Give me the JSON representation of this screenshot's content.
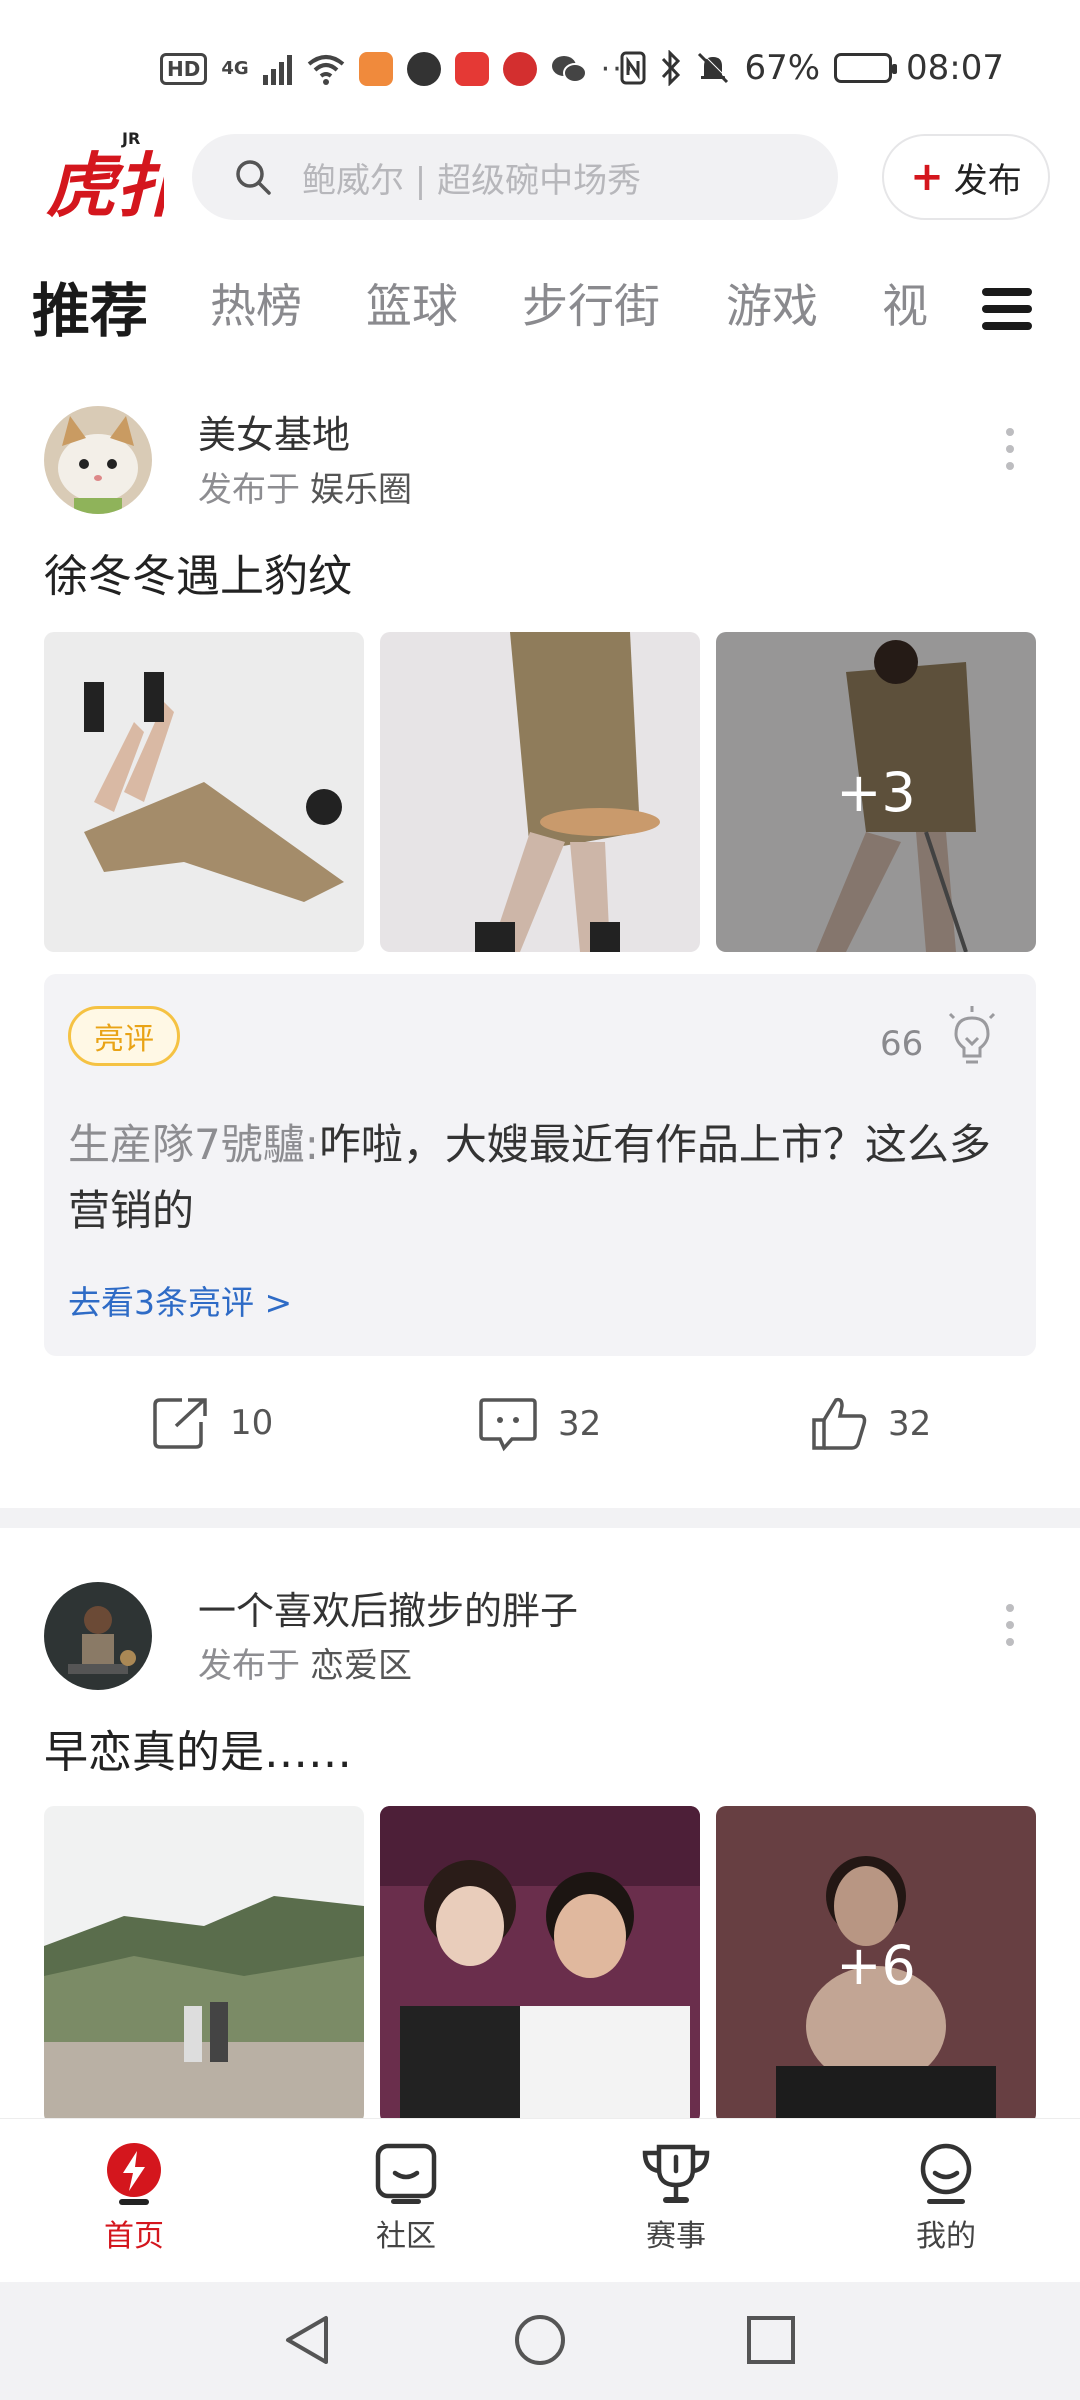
{
  "status_bar": {
    "hd": "HD",
    "network": "4G",
    "dots": "···",
    "battery_percent": "67%",
    "battery_level": 0.67,
    "time": "08:07"
  },
  "header": {
    "logo_text": "虎扑",
    "logo_badge": "JR",
    "search_placeholder": "鲍威尔 | 超级碗中场秀",
    "publish_label": "发布"
  },
  "tabs": [
    {
      "label": "推荐",
      "active": true
    },
    {
      "label": "热榜"
    },
    {
      "label": "篮球"
    },
    {
      "label": "步行街"
    },
    {
      "label": "游戏"
    },
    {
      "label": "视"
    }
  ],
  "posts": [
    {
      "username": "美女基地",
      "published_prefix": "发布于",
      "circle": "娱乐圈",
      "title": "徐冬冬遇上豹纹",
      "more_images": "+3",
      "comment": {
        "badge": "亮评",
        "likes": "66",
        "author": "生産隊7號驢:",
        "text": "咋啦，大嫂最近有作品上市？这么多营销的",
        "link": "去看3条亮评 >"
      },
      "shares": "10",
      "comments": "32",
      "upvotes": "32"
    },
    {
      "username": "一个喜欢后撤步的胖子",
      "published_prefix": "发布于",
      "circle": "恋爱区",
      "title": "早恋真的是……",
      "more_images": "+6"
    }
  ],
  "bottom_nav": [
    {
      "label": "首页",
      "icon": "home-lightning-icon",
      "active": true
    },
    {
      "label": "社区",
      "icon": "community-chat-icon"
    },
    {
      "label": "赛事",
      "icon": "trophy-icon"
    },
    {
      "label": "我的",
      "icon": "profile-icon"
    }
  ],
  "colors": {
    "brand_red": "#d4161d",
    "badge_yellow": "#f5c243",
    "link_blue": "#2e6bc6"
  }
}
